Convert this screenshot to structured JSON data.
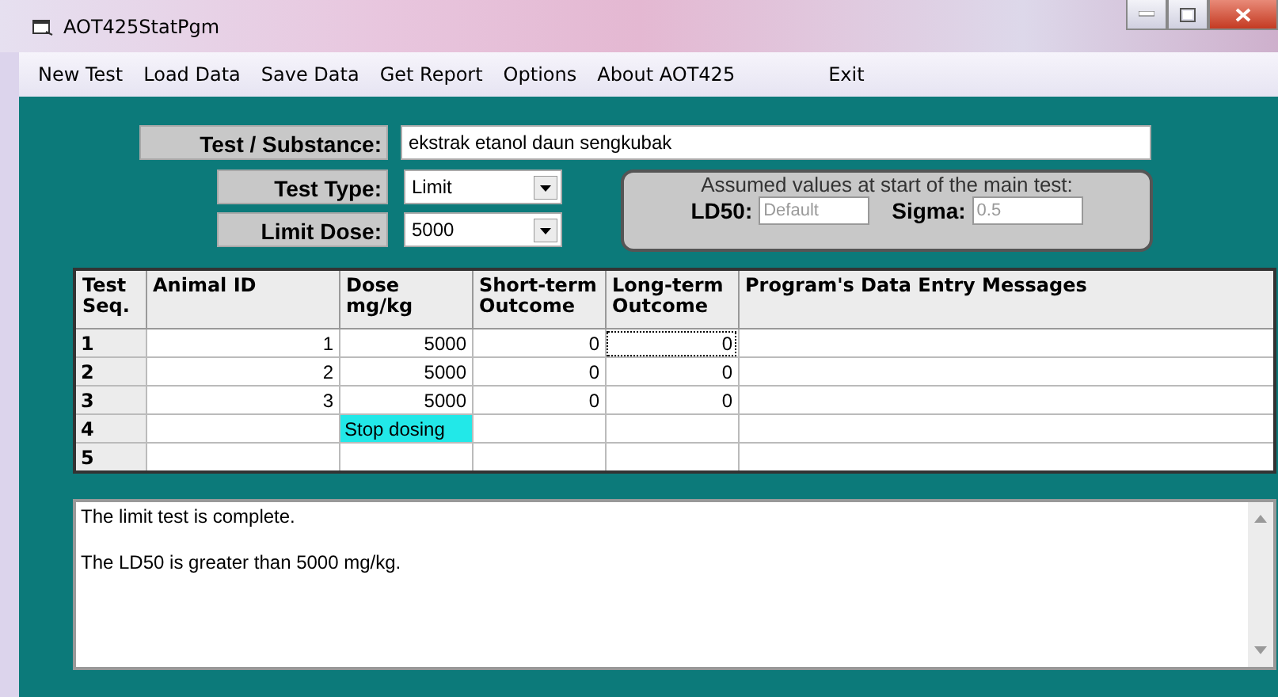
{
  "window": {
    "title": "AOT425StatPgm"
  },
  "menu": [
    "New Test",
    "Load Data",
    "Save Data",
    "Get Report",
    "Options",
    "About AOT425",
    "Exit"
  ],
  "substance": {
    "label": "Test / Substance:",
    "value": "ekstrak etanol daun sengkubak"
  },
  "test_type": {
    "label": "Test Type:",
    "value": "Limit"
  },
  "limit_dose": {
    "label": "Limit Dose:",
    "value": "5000"
  },
  "assumed": {
    "title": "Assumed values at start of the main test:",
    "ld50_label": "LD50:",
    "ld50_placeholder": "Default",
    "sigma_label": "Sigma:",
    "sigma_value": "0.5"
  },
  "table": {
    "columns": [
      "Test Seq.",
      "Animal ID",
      "Dose mg/kg",
      "Short-term Outcome",
      "Long-term Outcome",
      "Program's Data Entry Messages"
    ],
    "rows": [
      {
        "seq": "1",
        "animal_id": "1",
        "dose": "5000",
        "short_term": "0",
        "long_term": "0",
        "dose_highlighted": false,
        "long_term_focused": true
      },
      {
        "seq": "2",
        "animal_id": "2",
        "dose": "5000",
        "short_term": "0",
        "long_term": "0",
        "dose_highlighted": false,
        "long_term_focused": false
      },
      {
        "seq": "3",
        "animal_id": "3",
        "dose": "5000",
        "short_term": "0",
        "long_term": "0",
        "dose_highlighted": false,
        "long_term_focused": false
      },
      {
        "seq": "4",
        "dose": "Stop dosing",
        "dose_highlighted": true,
        "long_term_focused": false
      },
      {
        "seq": "5",
        "dose_highlighted": false,
        "long_term_focused": false
      }
    ]
  },
  "output": [
    "The limit test is complete.",
    "The LD50 is greater than 5000 mg/kg."
  ]
}
